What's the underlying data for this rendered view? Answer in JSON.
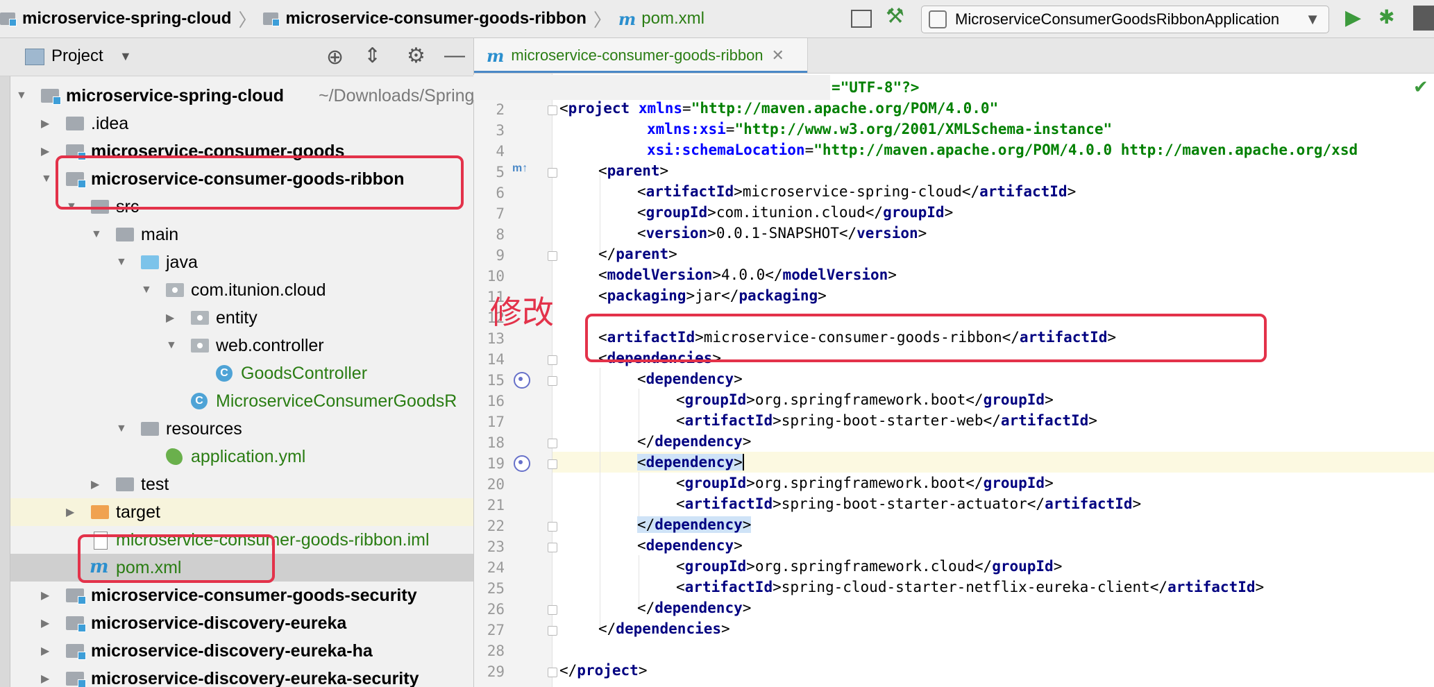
{
  "breadcrumb": {
    "project": "microservice-spring-cloud",
    "module": "microservice-consumer-goods-ribbon",
    "file": "pom.xml",
    "file_icon": "m"
  },
  "toolbar": {
    "run_config": "MicroserviceConsumerGoodsRibbonApplication"
  },
  "project_panel": {
    "title": "Project",
    "root_path": "~/Downloads/SpringCloud/Code/microservice-spring-cloud",
    "tree": [
      {
        "label": "microservice-spring-cloud",
        "bold": true
      },
      {
        "label": ".idea"
      },
      {
        "label": "microservice-consumer-goods",
        "bold": true
      },
      {
        "label": "microservice-consumer-goods-ribbon",
        "bold": true
      },
      {
        "label": "src"
      },
      {
        "label": "main"
      },
      {
        "label": "java"
      },
      {
        "label": "com.itunion.cloud"
      },
      {
        "label": "entity"
      },
      {
        "label": "web.controller"
      },
      {
        "label": "GoodsController"
      },
      {
        "label": "MicroserviceConsumerGoodsR"
      },
      {
        "label": "resources"
      },
      {
        "label": "application.yml"
      },
      {
        "label": "test"
      },
      {
        "label": "target"
      },
      {
        "label": "microservice-consumer-goods-ribbon.iml"
      },
      {
        "label": "pom.xml"
      },
      {
        "label": "microservice-consumer-goods-security",
        "bold": true
      },
      {
        "label": "microservice-discovery-eureka",
        "bold": true
      },
      {
        "label": "microservice-discovery-eureka-ha",
        "bold": true
      },
      {
        "label": "microservice-discovery-eureka-security",
        "bold": true
      }
    ]
  },
  "editor": {
    "tab_label": "microservice-consumer-goods-ribbon",
    "line1_tail": "=\"UTF-8\"?>",
    "annotation": "修改",
    "line_numbers": [
      "2",
      "3",
      "4",
      "5",
      "6",
      "7",
      "8",
      "9",
      "10",
      "11",
      "12",
      "13",
      "14",
      "15",
      "16",
      "17",
      "18",
      "19",
      "20",
      "21",
      "22",
      "23",
      "24",
      "25",
      "26",
      "27",
      "28",
      "29"
    ],
    "code": {
      "project_open": "project",
      "xmlns_attr": "xmlns",
      "xmlns_val": "\"http://maven.apache.org/POM/4.0.0\"",
      "xsi_attr": "xmlns:xsi",
      "xsi_val": "\"http://www.w3.org/2001/XMLSchema-instance\"",
      "schema_attr": "xsi:schemaLocation",
      "schema_val": "\"http://maven.apache.org/POM/4.0.0 http://maven.apache.org/xsd",
      "parent": "parent",
      "artifactId": "artifactId",
      "groupId": "groupId",
      "version": "version",
      "modelVersion": "modelVersion",
      "packaging": "packaging",
      "dependencies": "dependencies",
      "dependency": "dependency",
      "parent_artifact": "microservice-spring-cloud",
      "parent_group": "com.itunion.cloud",
      "parent_version": "0.0.1-SNAPSHOT",
      "model_version": "4.0.0",
      "packaging_val": "jar",
      "artifact_val": "microservice-consumer-goods-ribbon",
      "dep1_group": "org.springframework.boot",
      "dep1_artifact": "spring-boot-starter-web",
      "dep2_group": "org.springframework.boot",
      "dep2_artifact": "spring-boot-starter-actuator",
      "dep3_group": "org.springframework.cloud",
      "dep3_artifact": "spring-cloud-starter-netflix-eureka-client"
    }
  },
  "colors": {
    "tag": "#000080",
    "attr": "#0000ff",
    "value": "#008000",
    "annotation_red": "#e3324a"
  }
}
